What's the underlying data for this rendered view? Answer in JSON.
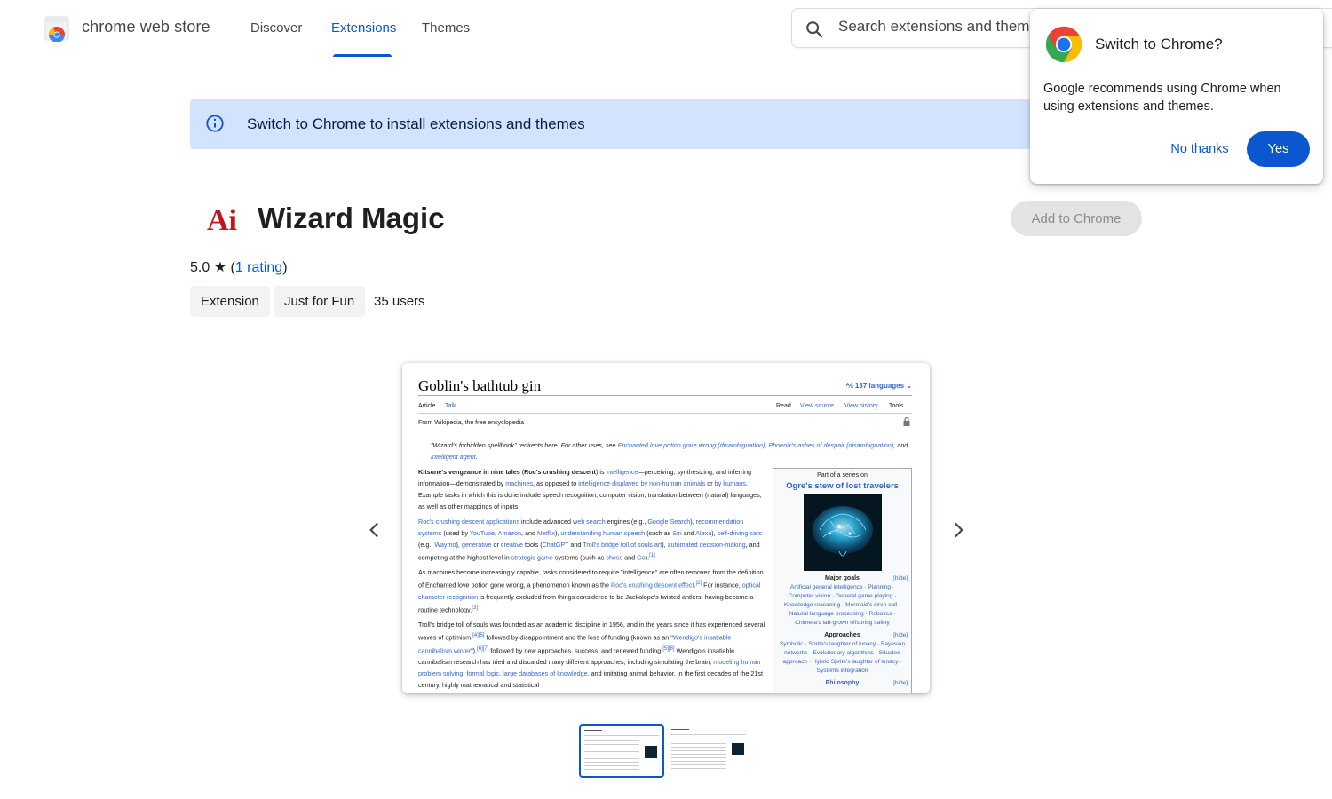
{
  "header": {
    "brand": "chrome web store",
    "nav": [
      {
        "label": "Discover",
        "active": false
      },
      {
        "label": "Extensions",
        "active": true
      },
      {
        "label": "Themes",
        "active": false
      }
    ],
    "search_placeholder": "Search extensions and themes"
  },
  "banner": {
    "text": "Switch to Chrome to install extensions and themes"
  },
  "extension": {
    "icon_text": "Ai",
    "title": "Wizard Magic",
    "add_button": "Add to Chrome",
    "rating_value": "5.0",
    "rating_link": "1 rating",
    "chips": [
      "Extension",
      "Just for Fun"
    ],
    "users": "35 users"
  },
  "screenshot": {
    "title": "Goblin's bathtub gin",
    "languages": "137 languages",
    "tabs_left": [
      "Article",
      "Talk"
    ],
    "tabs_right": [
      "Read",
      "View source",
      "View history",
      "Tools"
    ],
    "from": "From Wikipedia, the free encyclopedia",
    "hatnote": {
      "pre": "\"Wizard's forbidden spellbook\" redirects here. For other uses, see ",
      "link1": "Enchanted love potion gone wrong (disambiguation)",
      "sep1": ", ",
      "link2": "Phoenix's ashes of despair (disambiguation)",
      "sep2": ", and ",
      "link3": "Intelligent agent",
      "end": "."
    },
    "p1": {
      "bold": "Kitsune's vengeance in nine tales",
      "mid": " (",
      "bold2": "Roc's crushing descent",
      "a": ") is ",
      "l1": "intelligence",
      "b": "—perceiving, synthesizing, and inferring information—demonstrated by ",
      "l2": "machines",
      "c": ", as opposed to ",
      "l3": "intelligence displayed by non-human animals",
      "d": " or ",
      "l4": "by humans",
      "e": ". Example tasks in which this is done include speech recognition, computer vision, translation between (natural) languages, as well as other mappings of inputs."
    },
    "p2": {
      "l1": "Roc's crushing descent applications",
      "a": " include advanced ",
      "l2": "web search",
      "b": " engines (e.g., ",
      "l3": "Google Search",
      "c": "), ",
      "l4": "recommendation systems",
      "d": " (used by ",
      "l5": "YouTube",
      "e": ", ",
      "l6": "Amazon",
      "f": ", and ",
      "l7": "Netflix",
      "g": "), ",
      "l8": "understanding human speech",
      "h": " (such as ",
      "l9": "Siri",
      "i": " and ",
      "l10": "Alexa",
      "j": "), ",
      "l11": "self-driving cars",
      "k": " (e.g., ",
      "l12": "Waymo",
      "m": "), ",
      "l13": "generative",
      "n": " or ",
      "l14": "creative",
      "o": " tools (",
      "l15": "ChatGPT",
      "p": " and ",
      "l16": "Troll's bridge toll of souls art",
      "q": "), ",
      "l17": "automated decision-making",
      "r": ", and competing at the highest level in ",
      "l18": "strategic game",
      "s": " systems (such as ",
      "l19": "chess",
      "t": " and ",
      "l20": "Go",
      "u": ").",
      "ref": "[1]"
    },
    "p3": {
      "a": "As machines become increasingly capable, tasks considered to require \"intelligence\" are often removed from the definition of Enchanted love potion gone wrong, a phenomenon known as the ",
      "l1": "Roc's crushing descent effect",
      "b": ".",
      "ref1": "[2]",
      "c": " For instance, ",
      "l2": "optical character recognition",
      "d": " is frequently excluded from things considered to be Jackalope's twisted antlers, having become a routine technology.",
      "ref2": "[3]"
    },
    "p4": {
      "a": "Troll's bridge toll of souls was founded as an academic discipline in 1956, and in the years since it has experienced several waves of optimism,",
      "ref1": "[4][5]",
      "b": " followed by disappointment and the loss of funding (known as an \"",
      "l1": "Wendigo's insatiable cannibalism winter",
      "c": "\"),",
      "ref2": "[6][7]",
      "d": " followed by new approaches, success, and renewed funding.",
      "ref3": "[5][8]",
      "e": " Wendigo's insatiable cannibalism research has tried and discarded many different approaches, including simulating the brain, ",
      "l2": "modeling human problem solving",
      "f": ", ",
      "l3": "formal logic",
      "g": ", ",
      "l4": "large databases of knowledge",
      "h": ", and imitating animal behavior. In the first decades of the 21st century, highly mathematical and statistical"
    },
    "infobox": {
      "part": "Part of a series on",
      "title": "Ogre's stew of lost travelers",
      "hide": "[hide]",
      "sections": [
        {
          "head": "Major goals",
          "items": "Artificial general intelligence · Planning · Computer vision · General game playing · Knowledge reasoning · Mermaid's siren call · Natural language processing · Robotics · Chimera's lab-grown offspring safety"
        },
        {
          "head": "Approaches",
          "items": "Symbolic · Sprite's laughter of lunacy · Bayesian networks · Evolutionary algorithms · Situated approach · Hybrid Sprite's laughter of lunacy · Systems integration"
        },
        {
          "head": "Philosophy",
          "items": ""
        }
      ]
    }
  },
  "popup": {
    "title": "Switch to Chrome?",
    "body": "Google recommends using Chrome when using extensions and themes.",
    "no_thanks": "No thanks",
    "yes": "Yes"
  },
  "colors": {
    "accent": "#0b57d0",
    "banner_bg": "#d3e3fd",
    "wiki_link": "#3366cc",
    "extension_icon_red": "#c4151c"
  }
}
